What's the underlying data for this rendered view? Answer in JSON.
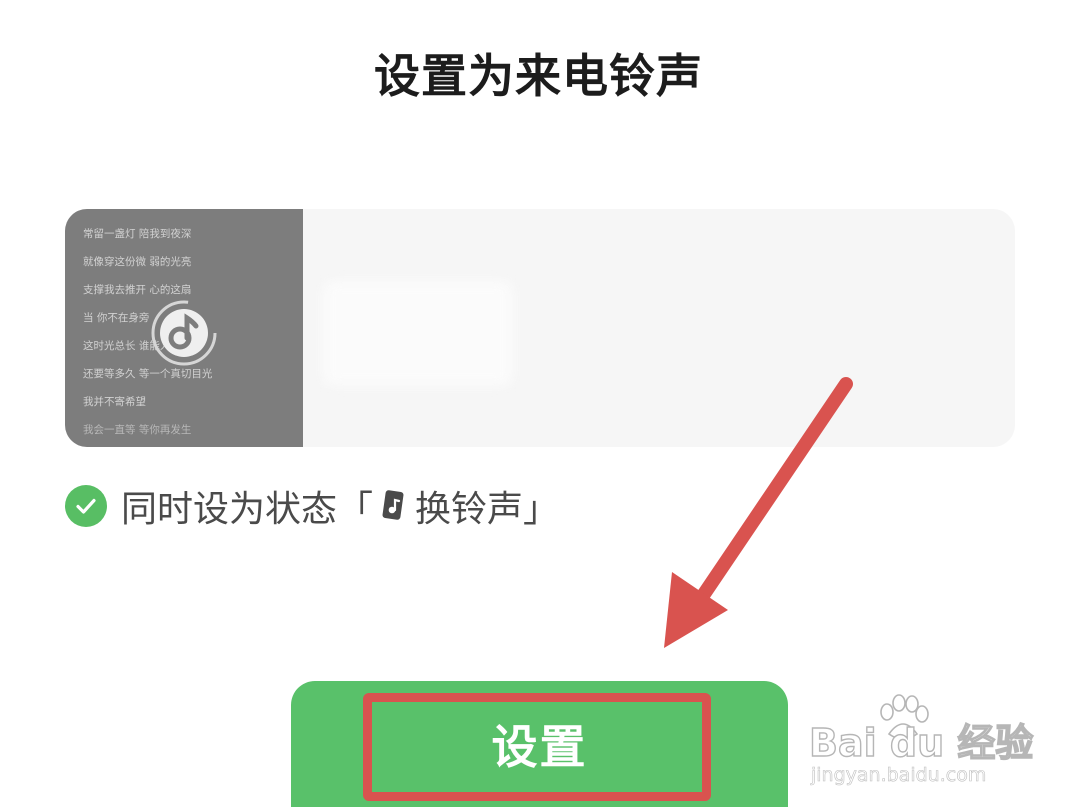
{
  "page": {
    "title": "设置为来电铃声"
  },
  "preview": {
    "lyrics": [
      "常留一盏灯 陪我到夜深",
      "就像穿这份微 弱的光亮",
      "支撑我去推开 心的这扇",
      "当 你不在身旁",
      "这时光总长 谁能人",
      "还要等多久 等一个真切目光",
      "我并不寄希望",
      "我会一直等 等你再发生"
    ],
    "badge_icon": "music-note-icon"
  },
  "status_option": {
    "checked": true,
    "prefix_text": "同时设为状态「",
    "suffix_text": "换铃声」",
    "icon": "music-card-icon"
  },
  "action": {
    "set_label": "设置"
  },
  "annotation": {
    "arrow_color": "#d9534f"
  },
  "watermark": {
    "brand": "Bai du 经验",
    "url": "jingyan.baidu.com"
  },
  "colors": {
    "accent_green": "#59c16a",
    "highlight_red": "#d9534f"
  }
}
